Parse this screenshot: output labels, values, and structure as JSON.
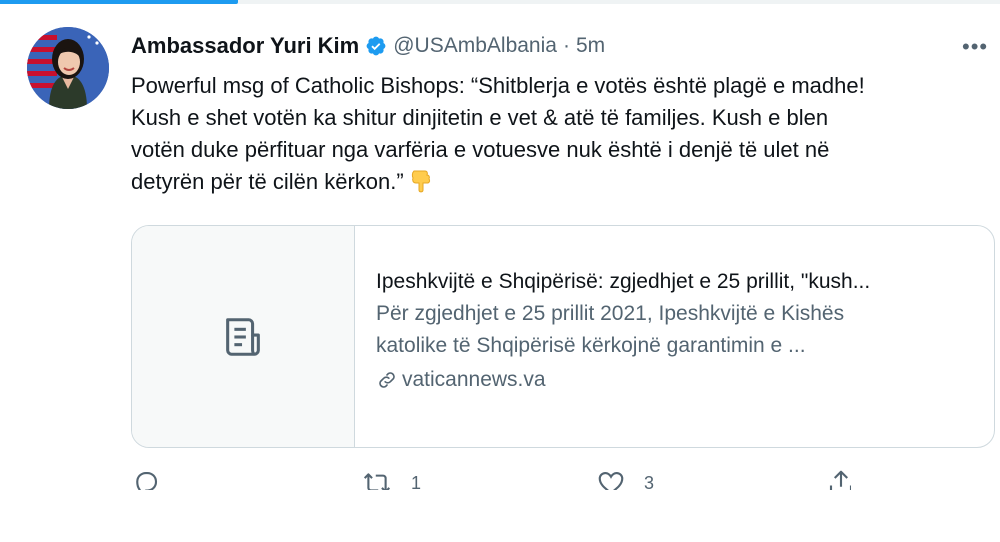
{
  "tweet": {
    "author_name": "Ambassador Yuri Kim",
    "handle": "@USAmbAlbania",
    "separator": "·",
    "time": "5m",
    "more_label": "•••",
    "text_lines": [
      "Powerful msg of Catholic Bishops: “Shitblerja e votës është plagë e madhe!",
      "Kush e shet votën ka shitur dinjitetin e vet & atë të familjes. Kush e blen",
      "votën duke përfituar nga varfëria e votuesve nuk është i denjë të ulet në",
      "detyrën për të cilën kërkon.”"
    ],
    "emoji": "pointing-down-emoji"
  },
  "card": {
    "title": "Ipeshkvijtë e Shqipërisë: zgjedhjet e 25 prillit, \"kush...",
    "description_lines": [
      "Për zgjedhjet e 25 prillit 2021, Ipeshkvijtë e Kishës",
      "katolike të Shqipërisë kërkojnë garantimin e ..."
    ],
    "domain": "vaticannews.va",
    "thumbnail_icon": "document-icon"
  },
  "actions": {
    "reply_count": "",
    "retweet_count": "1",
    "like_count": "3",
    "share_count": ""
  },
  "colors": {
    "accent": "#1d9bf0",
    "text_primary": "#0f1419",
    "text_secondary": "#536471",
    "border": "#cfd9de"
  }
}
